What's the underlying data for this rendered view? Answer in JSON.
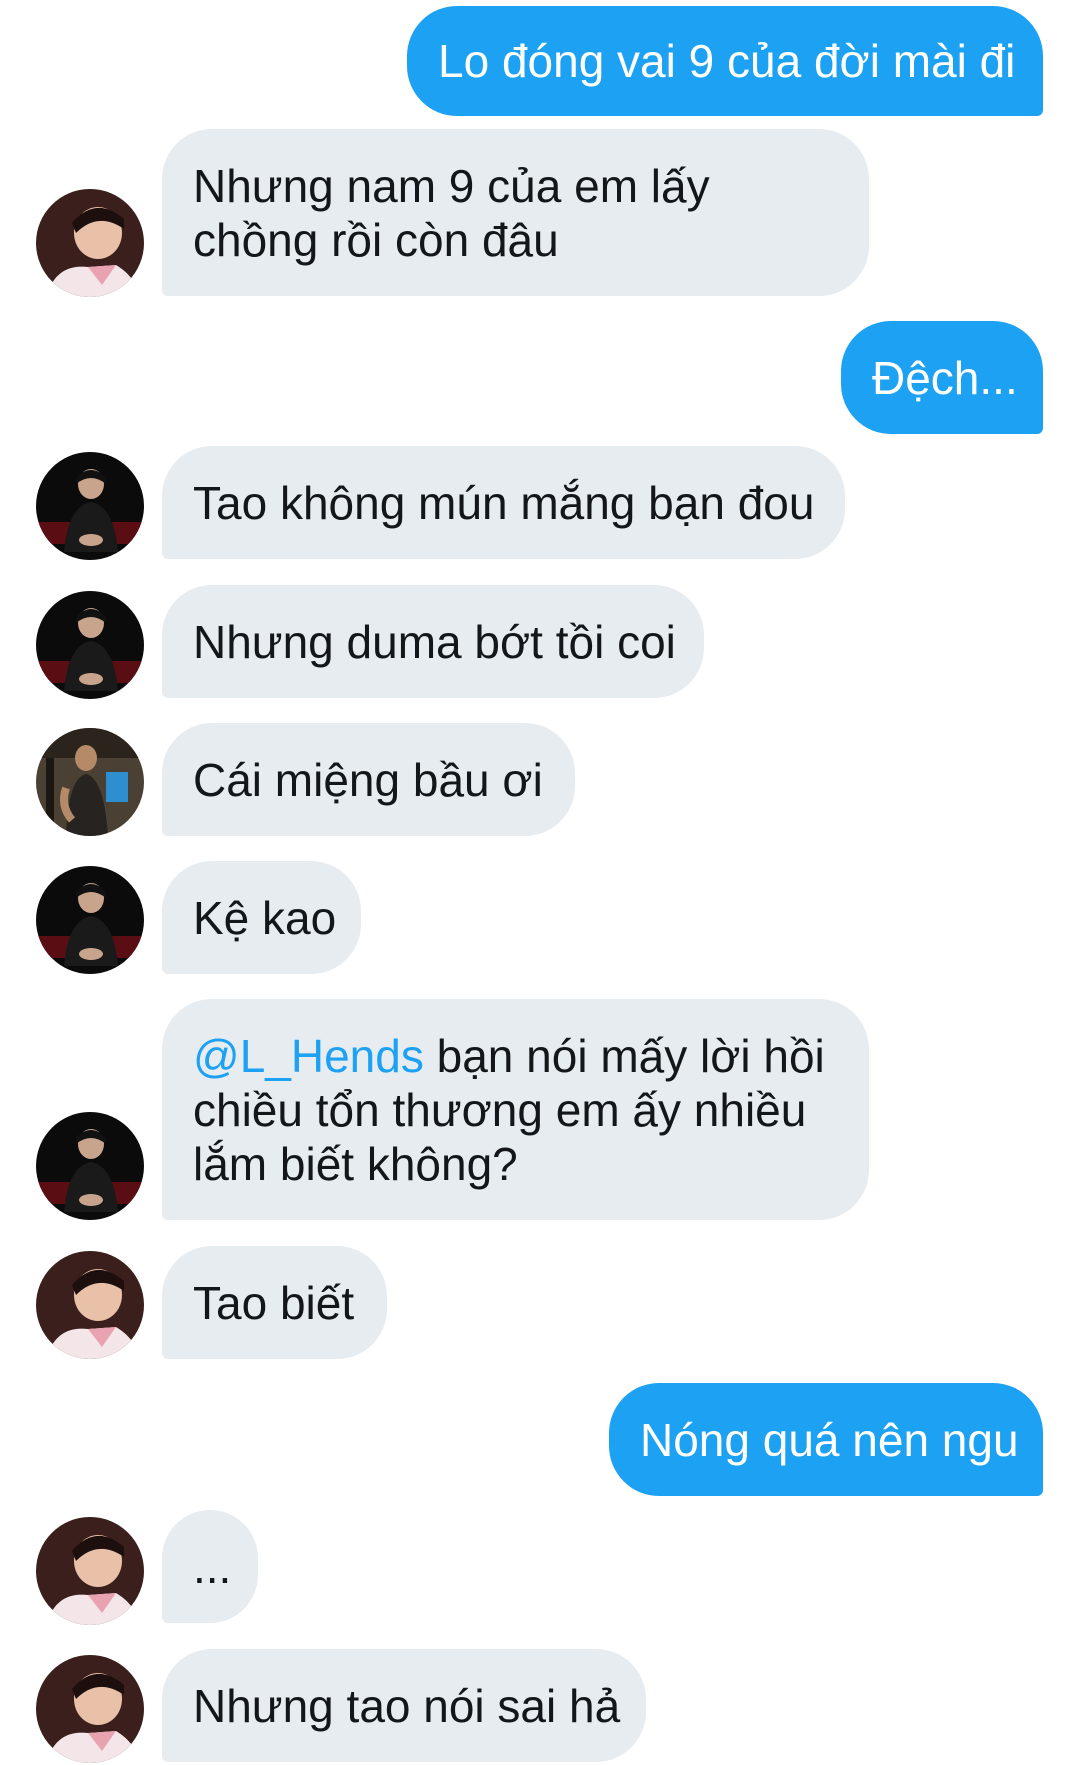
{
  "messages": [
    {
      "dir": "out",
      "text": "Lo đóng vai 9 của đời mài đi"
    },
    {
      "dir": "in",
      "avatar": "avatar-pink",
      "text": "Nhưng nam 9 của em lấy\nchồng rồi còn đâu"
    },
    {
      "dir": "out",
      "text": "Đệch..."
    },
    {
      "dir": "in",
      "avatar": "avatar-dark",
      "text": "Tao không mún mắng bạn đou"
    },
    {
      "dir": "in",
      "avatar": "avatar-dark",
      "text": "Nhưng duma bớt tồi coi"
    },
    {
      "dir": "in",
      "avatar": "avatar-gym",
      "text": "Cái miệng bầu ơi"
    },
    {
      "dir": "in",
      "avatar": "avatar-dark",
      "text": "Kệ kao"
    },
    {
      "dir": "in",
      "avatar": "avatar-dark",
      "mention": "@L_Hends",
      "text": " bạn nói mấy lời hồi chiều tổn thương em ấy nhiều lắm biết không?"
    },
    {
      "dir": "in",
      "avatar": "avatar-pink",
      "text": "Tao biết"
    },
    {
      "dir": "out",
      "text": "Nóng quá nên ngu"
    },
    {
      "dir": "in",
      "avatar": "avatar-pink",
      "text": "..."
    },
    {
      "dir": "in",
      "avatar": "avatar-pink",
      "text": "Nhưng tao nói sai hả"
    }
  ],
  "colors": {
    "outgoing_bubble": "#1da1f2",
    "incoming_bubble": "#e6ecf0",
    "mention": "#1da1f2",
    "text": "#14171a"
  }
}
